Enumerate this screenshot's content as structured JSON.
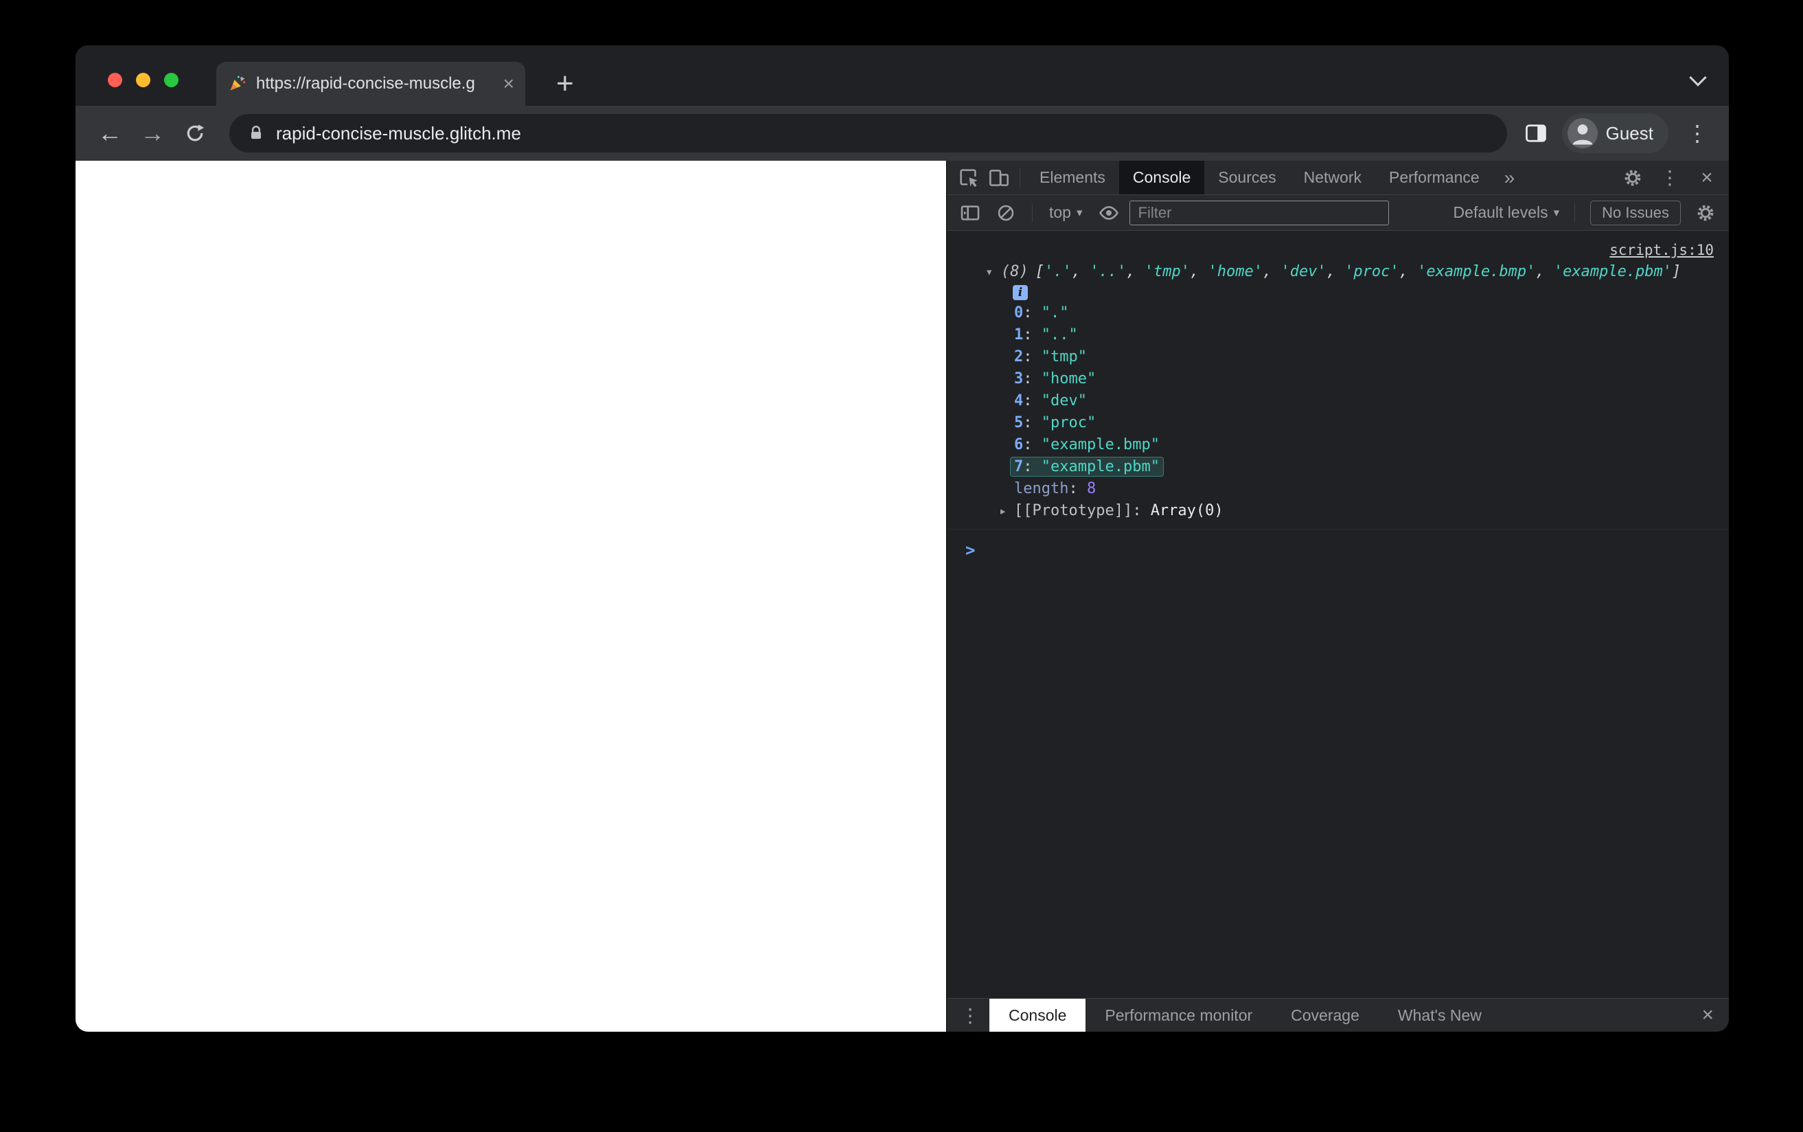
{
  "browser": {
    "tab_title": "https://rapid-concise-muscle.g",
    "address": "rapid-concise-muscle.glitch.me",
    "profile_label": "Guest"
  },
  "devtools": {
    "tabs": [
      "Elements",
      "Console",
      "Sources",
      "Network",
      "Performance"
    ],
    "active_tab": "Console",
    "toolbar": {
      "context_label": "top",
      "filter_placeholder": "Filter",
      "levels_label": "Default levels",
      "issues_label": "No Issues"
    },
    "console": {
      "source_link": "script.js:10",
      "count": "(8)",
      "items": [
        ".",
        "..",
        "tmp",
        "home",
        "dev",
        "proc",
        "example.bmp",
        "example.pbm"
      ],
      "highlighted_index": 7,
      "length_label": "length",
      "length_value": "8",
      "prototype_label": "[[Prototype]]",
      "prototype_value": "Array(0)"
    },
    "drawer": {
      "tabs": [
        "Console",
        "Performance monitor",
        "Coverage",
        "What's New"
      ],
      "active_tab": "Console"
    }
  },
  "icons": {
    "back": "←",
    "forward": "→",
    "new_tab": "+",
    "close_tab": "×",
    "overflow_menu": "»",
    "kebab": "⋮",
    "close": "×",
    "caret_down": "▾",
    "caret_right": "▸",
    "prompt": ">",
    "info": "i"
  },
  "colors": {
    "string_teal": "#4ED7C8",
    "index_blue": "#7CACF8",
    "number_purple": "#9980FF",
    "accent_blue": "#8AB4F8",
    "traffic_red": "#FF5F57",
    "traffic_yellow": "#FEBC2E",
    "traffic_green": "#28C840"
  }
}
